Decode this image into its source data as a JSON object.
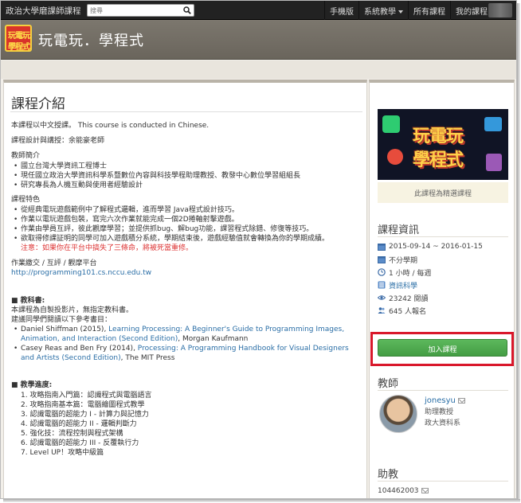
{
  "topbar": {
    "brand": "政治大學磨課師課程",
    "search_placeholder": "搜尋",
    "nav": [
      "手機版",
      "系統教學",
      "所有課程",
      "我的課程"
    ]
  },
  "header": {
    "logo_line1": "玩電玩",
    "logo_line2": "學程式",
    "title": "玩電玩．學程式"
  },
  "main": {
    "title": "課程介紹",
    "lang_note": "本課程以中文授課。 This course is conducted in Chinese.",
    "designer": "課程設計與講授：余能豪老師",
    "teacher_intro_title": "教師簡介",
    "teacher_intro": [
      "國立台灣大學資訊工程博士",
      "現任國立政治大學資訊科學系暨數位內容與科技學程助理教授、教發中心數位學習組組長",
      "研究專長為人機互動與使用者經驗設計"
    ],
    "features_title": "課程特色",
    "features": [
      "從經典電玩遊戲範例中了解程式邏輯，進而學習 Java程式設計技巧。",
      "作業以電玩遊戲包裝，寫完六次作業就能完成一個2D捲軸射擊遊戲。",
      "作業由學員互評，彼此觀摩學習；並提供抓bug、解bug功能，課習程式除錯、修復等技巧。",
      "欲取得修課証明的同學可加入遊戲積分系統，學期結束後，遊戲經驗值就會轉換為你的學期成績。"
    ],
    "warning": "注意：如果你在平台中搞失了三條命，將被死當重修。",
    "platform_label": "作業繳交 / 互評 / 觀摩平台",
    "platform_url": "http://programming101.cs.nccu.edu.tw",
    "textbook_title": "■ 教科書:",
    "textbook_note": "本課程為自製投影片，無指定教科書。",
    "ref_note": "建議同學們閱讀以下參考書目：",
    "refs": [
      {
        "pre": "Daniel Shiffman (2015), ",
        "link": "Learning Processing: A Beginner's Guide to Programming Images, Animation, and Interaction (Second Edition)",
        "post": ", Morgan Kaufmann"
      },
      {
        "pre": "Casey Reas and Ben Fry (2014), ",
        "link": "Processing: A Programming Handbook for Visual Designers and Artists (Second Edition)",
        "post": ", The MIT Press"
      }
    ],
    "progress_title": "■ 教學進度:",
    "progress": [
      "1.  攻略指南入門篇：認識程式與電腦語言",
      "2.  攻略指南基本篇：電腦繪圖程式教學",
      "3.  認識電腦的超能力 I - 計算力與記憶力",
      "4.  認識電腦的超能力 II - 邏輯判斷力",
      "5.  強化技：流程控制與程式架構",
      "6.  認識電腦的超能力 III - 反覆執行力",
      "7.  Level UP！攻略中級篇"
    ]
  },
  "sidebar": {
    "cover_text1": "玩電玩",
    "cover_text2": "學程式",
    "selected_note": "此課程為精選課程",
    "info_title": "課程資訊",
    "info": {
      "dates": "2015-09-14 ~ 2016-01-15",
      "term": "不分學期",
      "hours": "1 小時 / 每週",
      "category": "資訊科學",
      "views": "23242 閱讀",
      "enrolled": "645 人報名"
    },
    "join_label": "加入課程",
    "teacher_title": "教師",
    "teacher_name": "jonesyu",
    "teacher_role": "助理教授",
    "teacher_dept": "政大資科系",
    "ta_title": "助教",
    "ta_id": "104462003"
  },
  "colors": {
    "accent_join": "#5cb85c",
    "highlight_box": "#d9182b",
    "link": "#2a6ea6",
    "warning": "#dd3333"
  }
}
